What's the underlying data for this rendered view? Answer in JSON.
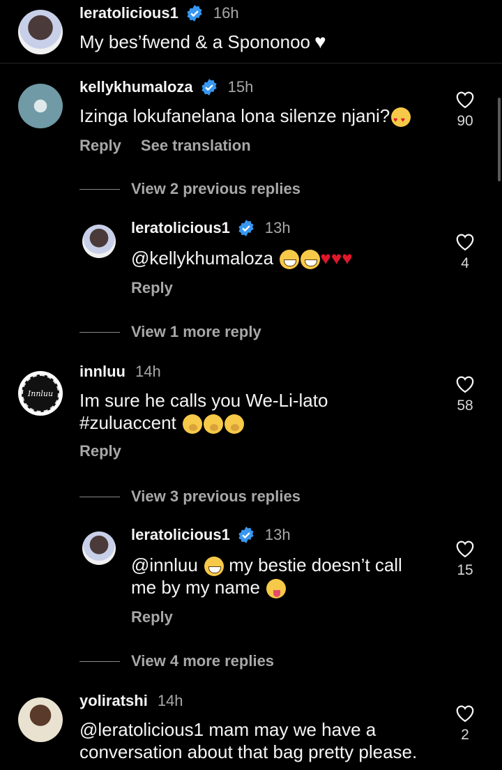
{
  "comments": [
    {
      "username": "leratolicious1",
      "time": "16h",
      "text": "My bes’fwend & a Spononoo",
      "verified": true
    },
    {
      "username": "kellykhumaloza",
      "time": "15h",
      "text": "Izinga lokufanelana lona silenze njani?",
      "verified": true,
      "reply_label": "Reply",
      "translate_label": "See translation",
      "likes": "90",
      "view_replies": "View 2 previous replies",
      "reply": {
        "username": "leratolicious1",
        "time": "13h",
        "text": "@kellykhumaloza",
        "reply_label": "Reply",
        "likes": "4",
        "view_more": "View 1 more reply"
      }
    },
    {
      "username": "innluu",
      "time": "14h",
      "avatar_text": "Innluu",
      "line1": "Im sure he calls you We-Li-lato",
      "line2": "#zuluaccent",
      "reply_label": "Reply",
      "likes": "58",
      "view_replies": "View 3 previous replies",
      "reply": {
        "username": "leratolicious1",
        "time": "13h",
        "line1a": "@innluu",
        "line1b": "my bestie doesn’t call",
        "line2": "me by my name",
        "reply_label": "Reply",
        "likes": "15",
        "view_more": "View 4 more replies"
      }
    },
    {
      "username": "yoliratshi",
      "time": "14h",
      "line1": "@leratolicious1 mam may we have a",
      "line2": "conversation about that bag pretty please.",
      "likes": "2"
    }
  ],
  "colors": {
    "background": "#000000",
    "verified": "#3897f0",
    "muted": "#a8a8a8"
  }
}
